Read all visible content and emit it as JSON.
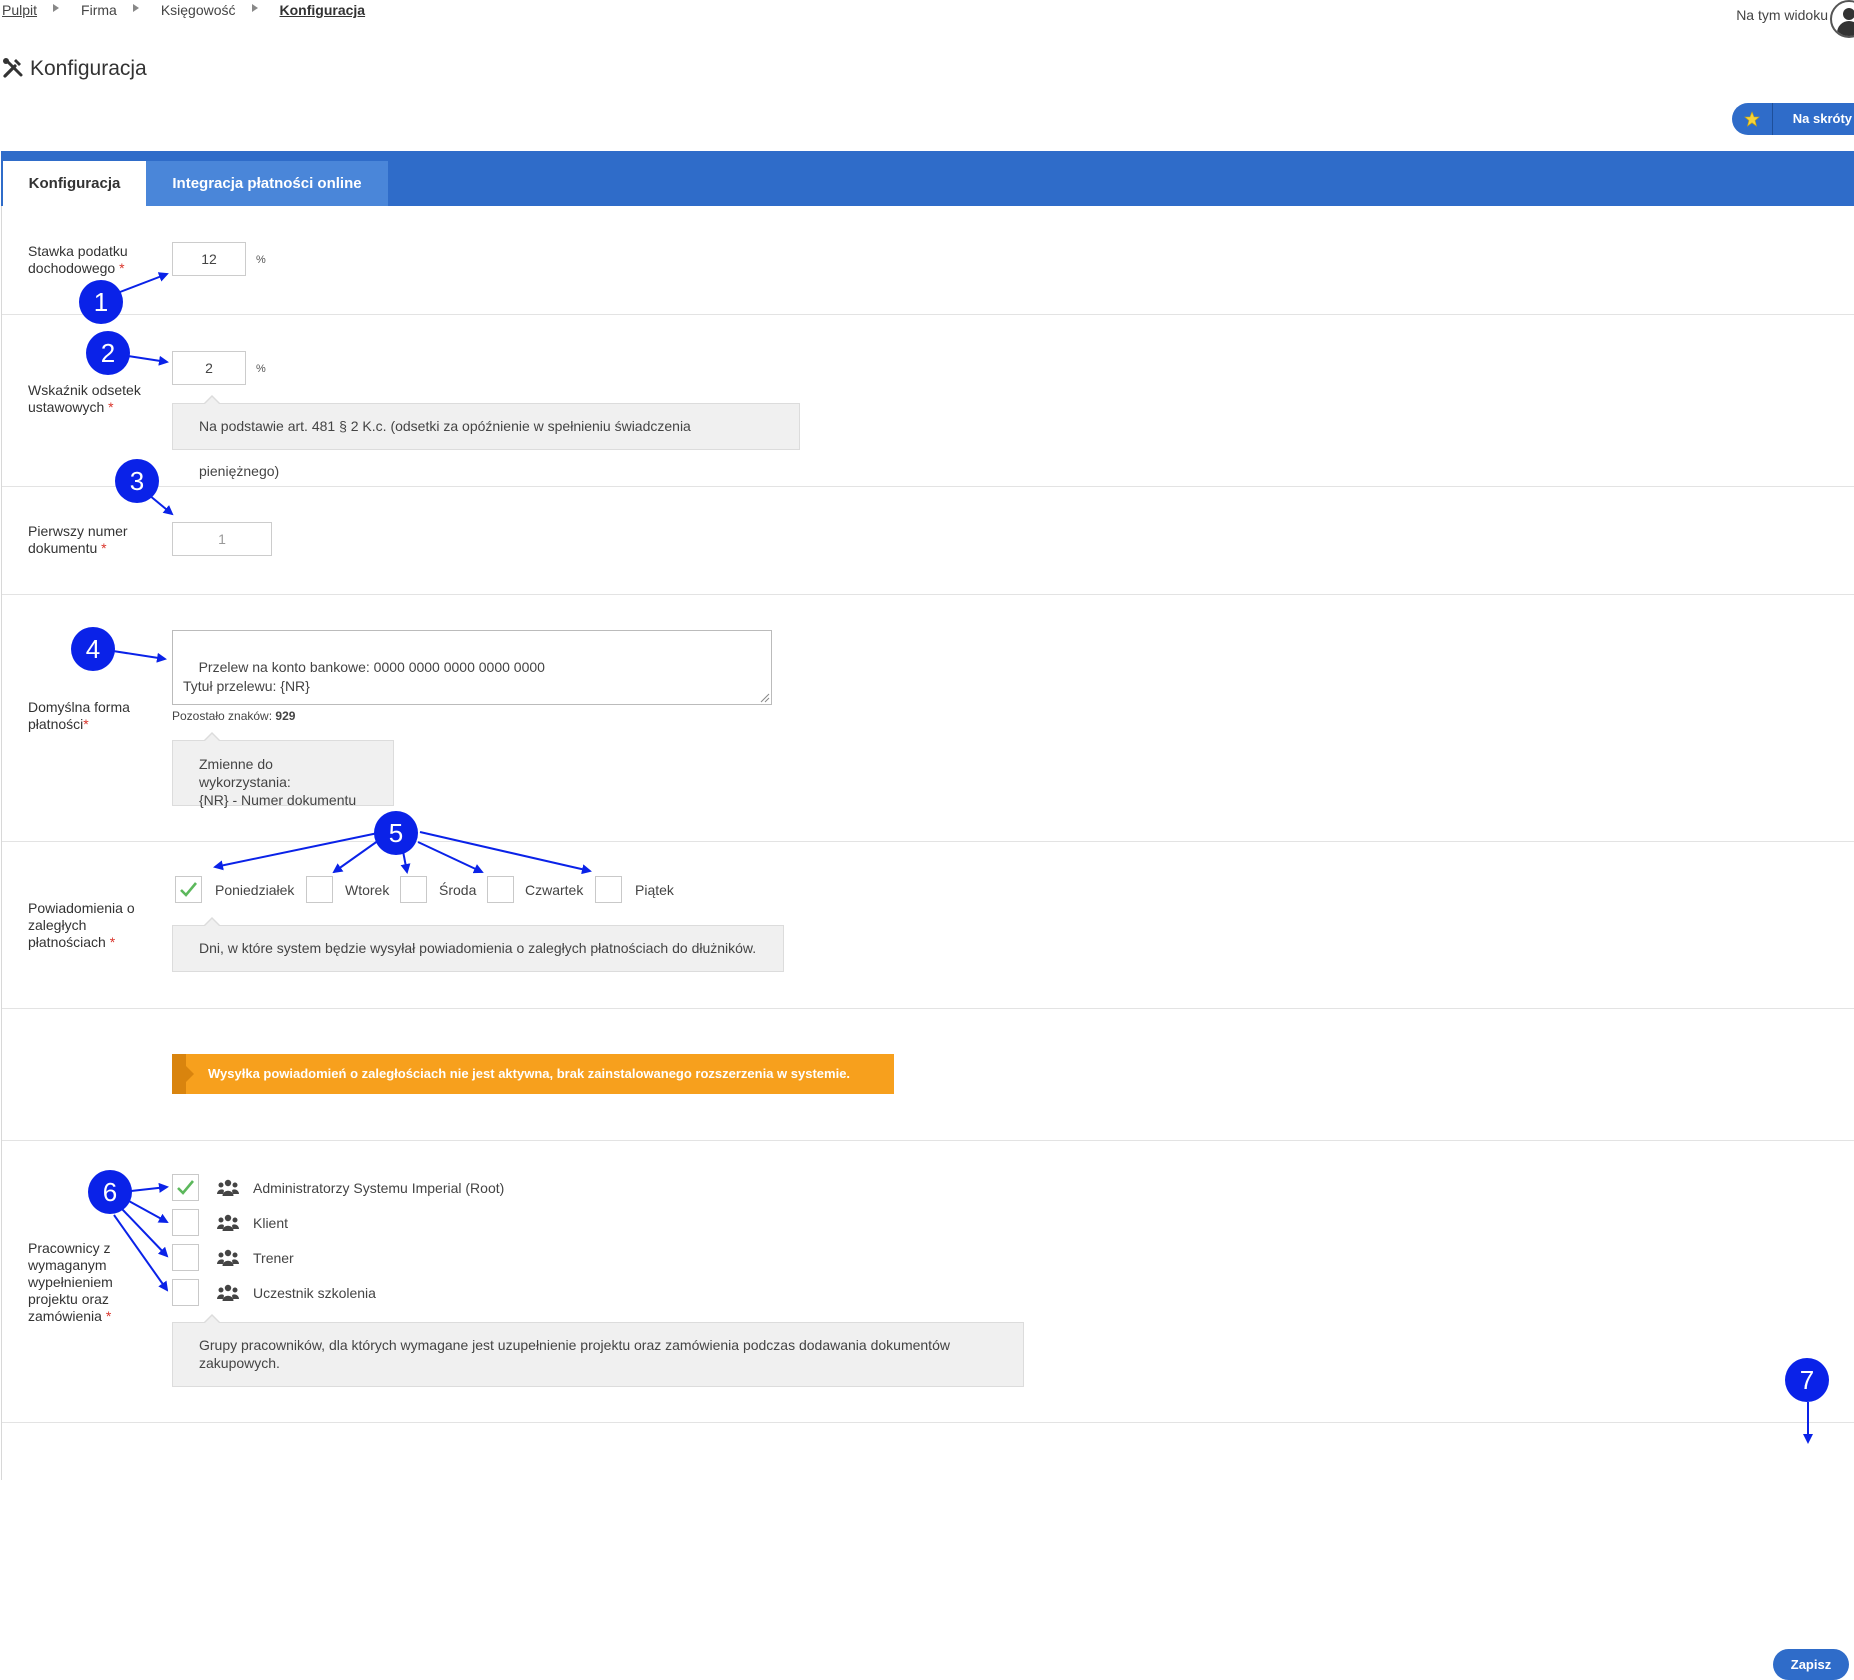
{
  "breadcrumb": [
    "Pulpit",
    "Firma",
    "Księgowość",
    "Konfiguracja"
  ],
  "header": {
    "view_label": "Na tym widoku",
    "title": "Konfiguracja",
    "shortcut_label": "Na skróty"
  },
  "tabs": [
    {
      "label": "Konfiguracja",
      "active": true
    },
    {
      "label": "Integracja płatności online",
      "active": false
    }
  ],
  "fields": {
    "tax_rate": {
      "label_line1": "Stawka podatku",
      "label_line2": "dochodowego",
      "value": "12",
      "unit": "%"
    },
    "interest": {
      "label_line1": "Wskaźnik odsetek",
      "label_line2": "ustawowych",
      "value": "2",
      "unit": "%",
      "hint": "Na podstawie art. 481 § 2 K.c. (odsetki za opóźnienie w spełnieniu świadczenia pieniężnego)"
    },
    "first_doc": {
      "label_line1": "Pierwszy numer",
      "label_line2": "dokumentu",
      "placeholder": "1"
    },
    "payment": {
      "label_line1": "Domyślna forma",
      "label_line2": "płatności",
      "value": "Przelew na konto bankowe: 0000 0000 0000 0000 0000\nTytuł przelewu: {NR}",
      "remaining_label": "Pozostało znaków:",
      "remaining_count": "929",
      "hint_line1": "Zmienne do wykorzystania:",
      "hint_line2": "{NR} - Numer dokumentu"
    },
    "notifications": {
      "label_line1": "Powiadomienia o",
      "label_line2": "zaległych",
      "label_line3": "płatnościach",
      "days": [
        {
          "label": "Poniedziałek",
          "checked": true
        },
        {
          "label": "Wtorek",
          "checked": false
        },
        {
          "label": "Środa",
          "checked": false
        },
        {
          "label": "Czwartek",
          "checked": false
        },
        {
          "label": "Piątek",
          "checked": false
        }
      ],
      "hint": "Dni, w które system będzie wysyłał powiadomienia o zaległych płatnościach do dłużników."
    },
    "warning": "Wysyłka powiadomień o zaległościach nie jest aktywna, brak zainstalowanego rozszerzenia w systemie.",
    "employees": {
      "label_line1": "Pracownicy z",
      "label_line2": "wymaganym",
      "label_line3": "wypełnieniem",
      "label_line4": "projektu oraz",
      "label_line5": "zamówienia",
      "groups": [
        {
          "label": "Administratorzy Systemu Imperial (Root)",
          "checked": true
        },
        {
          "label": "Klient",
          "checked": false
        },
        {
          "label": "Trener",
          "checked": false
        },
        {
          "label": "Uczestnik szkolenia",
          "checked": false
        }
      ],
      "hint_line1": "Grupy pracowników, dla których wymagane jest uzupełnienie projektu oraz zamówienia podczas dodawania dokumentów",
      "hint_line2": "zakupowych."
    }
  },
  "save_label": "Zapisz",
  "required_mark": "*",
  "callouts": [
    "1",
    "2",
    "3",
    "4",
    "5",
    "6",
    "7"
  ],
  "colors": {
    "primary": "#2f6cc9",
    "warning": "#f7a01d",
    "callout": "#0a22e8",
    "check": "#5cb85c"
  }
}
